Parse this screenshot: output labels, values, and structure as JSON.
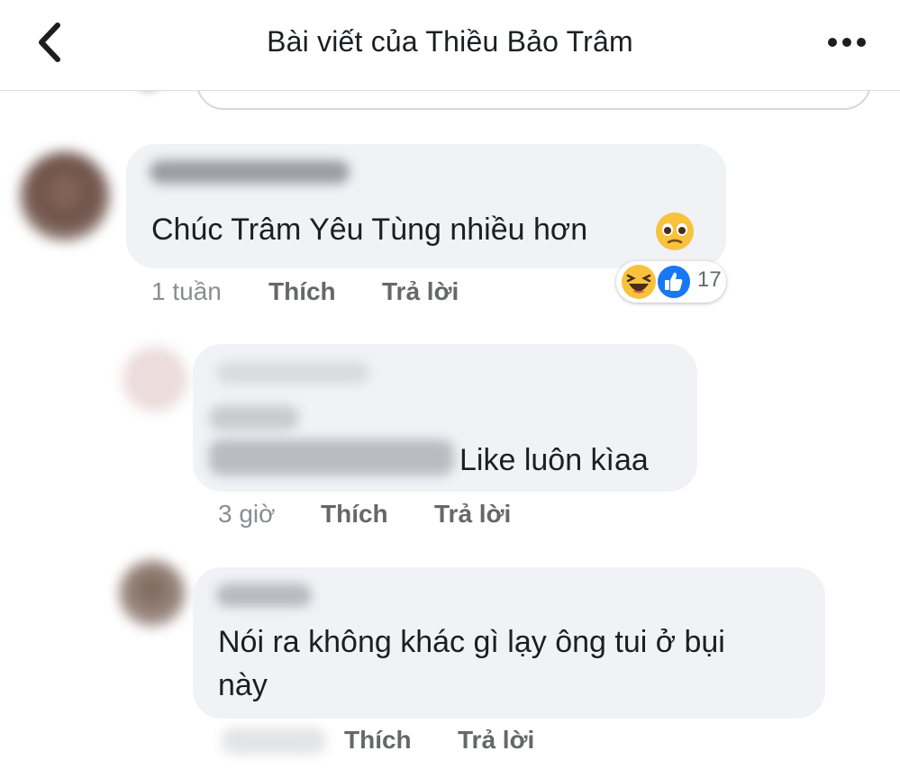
{
  "header": {
    "title": "Bài viết của Thiều Bảo Trâm"
  },
  "comments": [
    {
      "text": "Chúc Trâm Yêu Tùng nhiều hơn",
      "time": "1 tuần",
      "like_label": "Thích",
      "reply_label": "Trả lời",
      "reactions": [
        "haha-emoji",
        "like-emoji"
      ],
      "reaction_count": "17"
    },
    {
      "text": "Like luôn kìaa",
      "time": "3 giờ",
      "like_label": "Thích",
      "reply_label": "Trả lời"
    },
    {
      "text_line1": "Nói ra không khác gì lạy ông tui ở bụi",
      "text_line2": "này",
      "like_label": "Thích",
      "reply_label": "Trả lời"
    }
  ],
  "colors": {
    "bubble": "#f0f2f5",
    "text": "#1c1e21",
    "muted": "#65676b",
    "like_blue": "#1877f2",
    "emoji_yellow": "#f7c33d"
  }
}
